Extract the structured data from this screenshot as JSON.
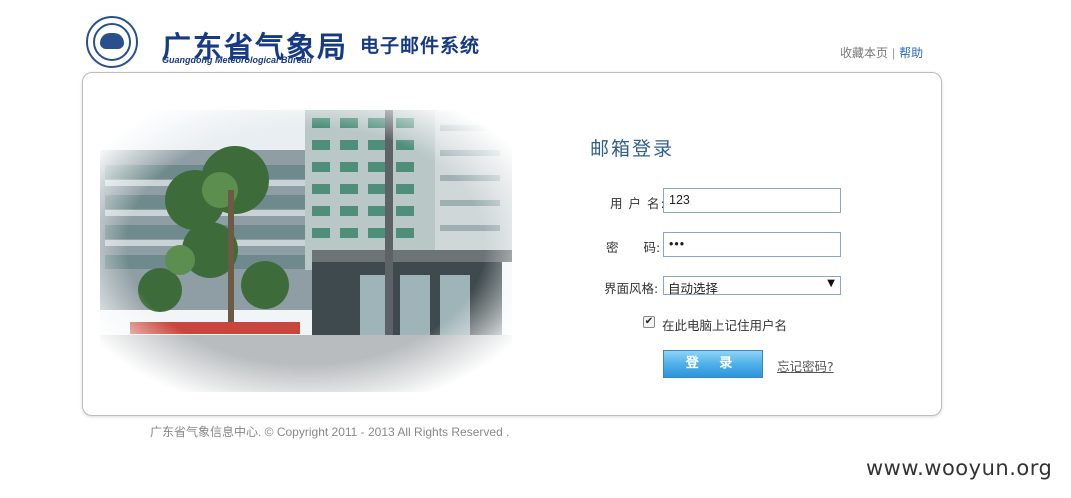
{
  "header": {
    "brand_cn": "广东省气象局",
    "brand_en": "Guangdong Meteorological Bureau",
    "system_name": "电子邮件系统",
    "links": {
      "favorite": "收藏本页",
      "separator": "|",
      "help": "帮助"
    }
  },
  "login": {
    "title": "邮箱登录",
    "username_label": "用 户 名:",
    "username_value": "123",
    "password_label": "密　　码:",
    "password_value": "•••",
    "style_label": "界面风格:",
    "style_selected": "自动选择",
    "remember_checked": true,
    "remember_label": "在此电脑上记住用户名",
    "submit_label": "登 录",
    "forgot_label": "忘记密码?"
  },
  "footer": {
    "copyright": "广东省气象信息中心. © Copyright 2011 - 2013 All Rights Reserved ."
  },
  "watermark": "www.wooyun.org",
  "icons": {
    "logo": "meteorological-bureau-logo-icon",
    "dropdown": "chevron-down-icon",
    "checkbox": "checkmark-icon"
  },
  "colors": {
    "brand": "#173a86",
    "title": "#2f5f8f",
    "button": "#2e95d8",
    "link": "#2a6bbd"
  }
}
